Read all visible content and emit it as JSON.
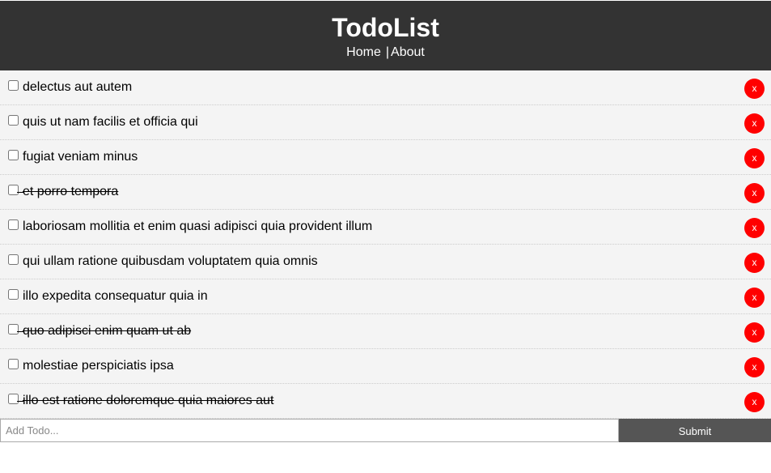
{
  "header": {
    "title": "TodoList",
    "nav": {
      "home": "Home",
      "separator": "|",
      "about": "About"
    }
  },
  "todos": [
    {
      "title": "delectus aut autem",
      "completed": false
    },
    {
      "title": "quis ut nam facilis et officia qui",
      "completed": false
    },
    {
      "title": "fugiat veniam minus",
      "completed": false
    },
    {
      "title": "et porro tempora",
      "completed": true
    },
    {
      "title": "laboriosam mollitia et enim quasi adipisci quia provident illum",
      "completed": false
    },
    {
      "title": "qui ullam ratione quibusdam voluptatem quia omnis",
      "completed": false
    },
    {
      "title": "illo expedita consequatur quia in",
      "completed": false
    },
    {
      "title": "quo adipisci enim quam ut ab",
      "completed": true
    },
    {
      "title": "molestiae perspiciatis ipsa",
      "completed": false
    },
    {
      "title": "illo est ratione doloremque quia maiores aut",
      "completed": true
    }
  ],
  "delete_label": "x",
  "form": {
    "placeholder": "Add Todo...",
    "value": "",
    "submit_label": "Submit"
  },
  "colors": {
    "header_bg": "#333333",
    "item_bg": "#f4f4f4",
    "delete_bg": "#ff0000",
    "submit_bg": "#555555"
  }
}
